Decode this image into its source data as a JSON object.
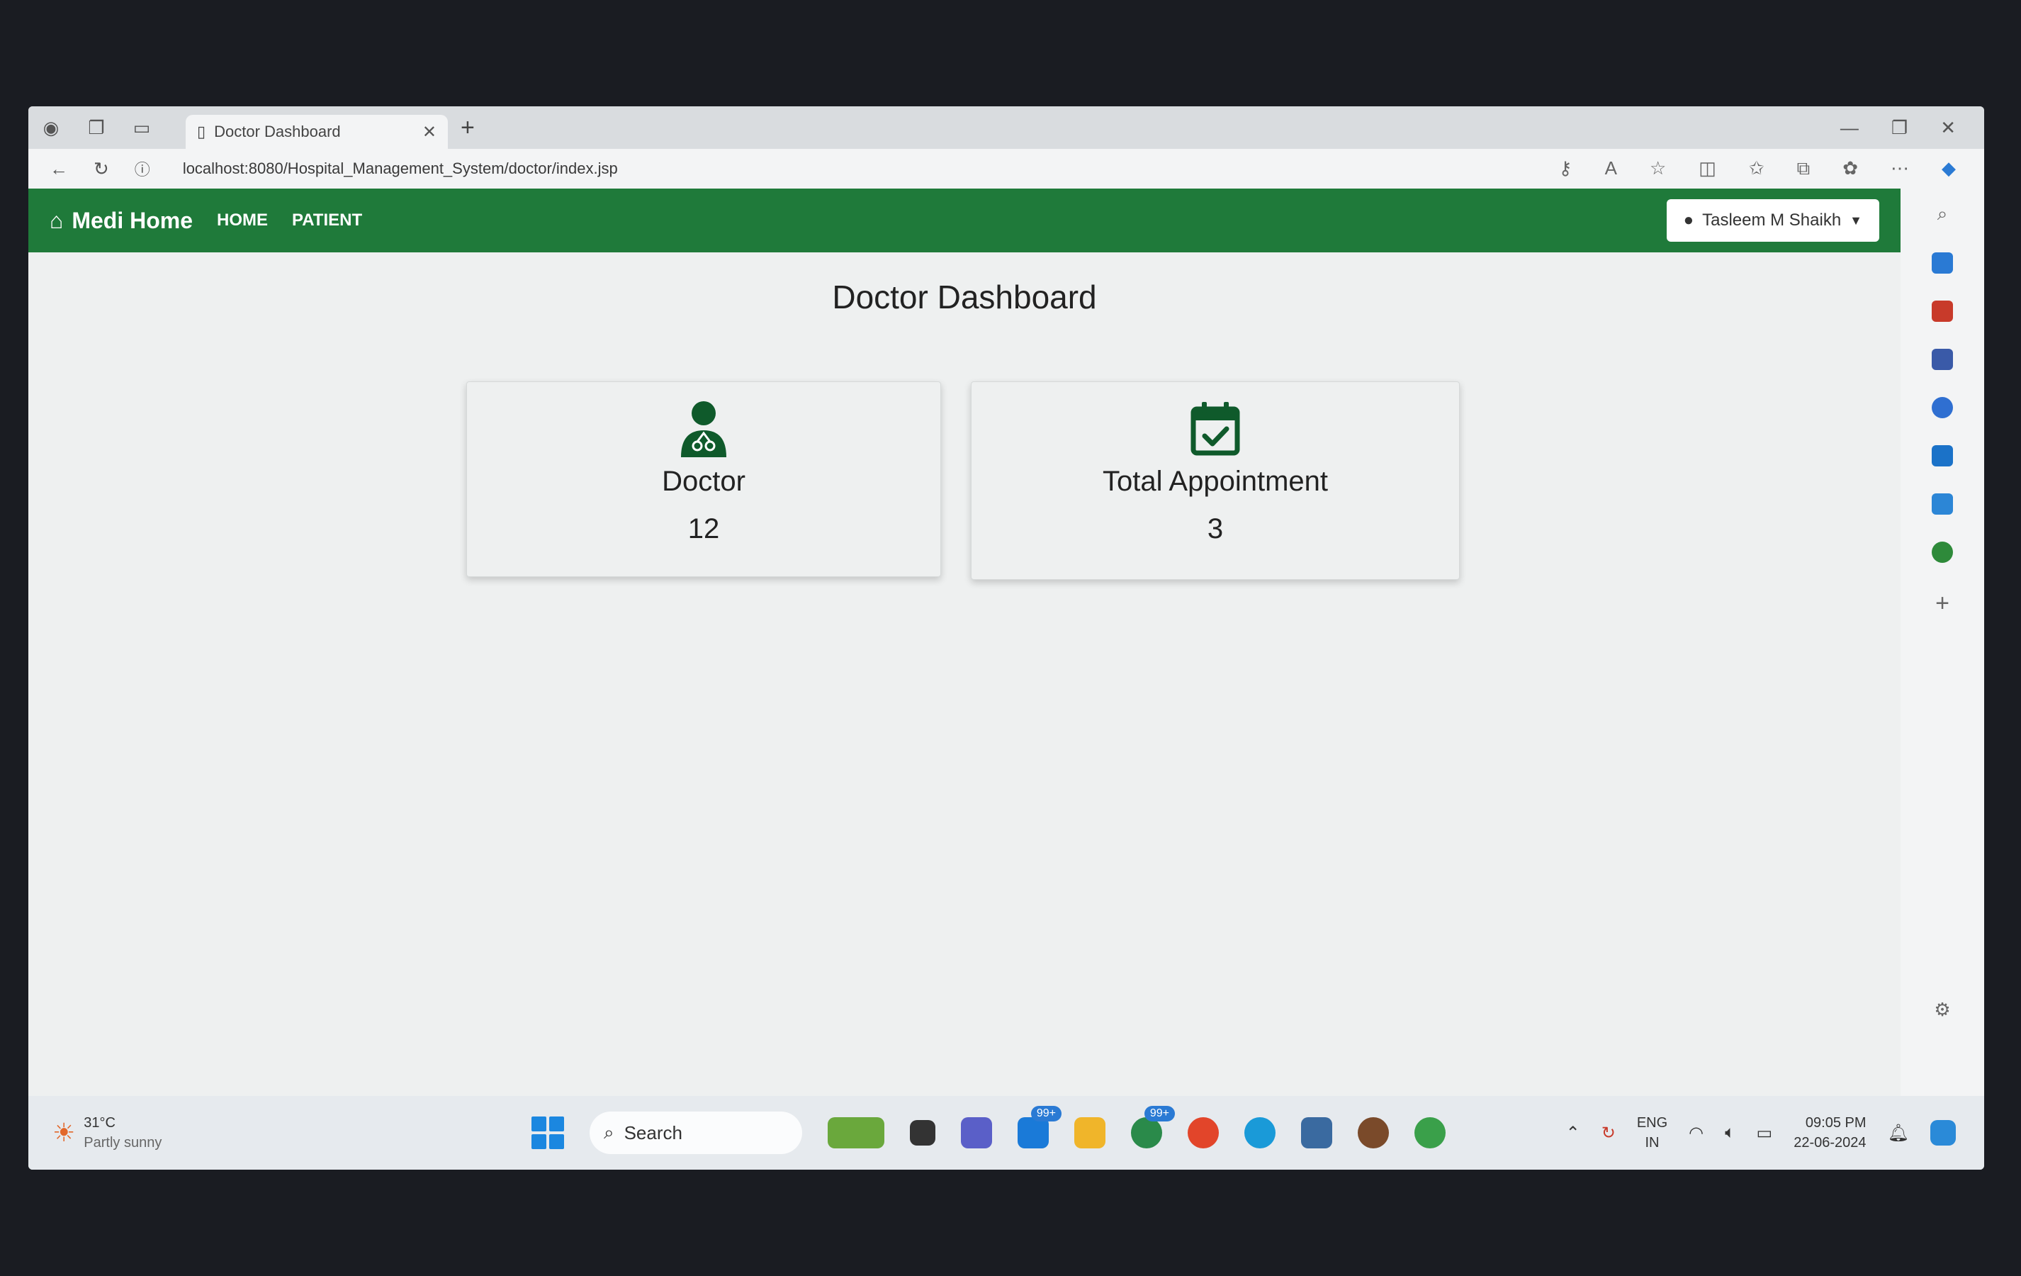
{
  "browser": {
    "tab_title": "Doctor Dashboard",
    "url": "localhost:8080/Hospital_Management_System/doctor/index.jsp"
  },
  "navbar": {
    "brand": "Medi Home",
    "links": [
      "HOME",
      "PATIENT"
    ],
    "user": "Tasleem M Shaikh"
  },
  "page": {
    "title": "Doctor Dashboard"
  },
  "cards": [
    {
      "label": "Doctor",
      "value": "12",
      "icon": "doctor-icon"
    },
    {
      "label": "Total Appointment",
      "value": "3",
      "icon": "calendar-check-icon"
    }
  ],
  "taskbar": {
    "temperature": "31°C",
    "weather": "Partly sunny",
    "search_placeholder": "Search",
    "mail_badge": "99+",
    "whatsapp_badge": "99+",
    "lang": "ENG",
    "region": "IN",
    "time": "09:05 PM",
    "date": "22-06-2024"
  },
  "colors": {
    "navbar": "#1f7a3a",
    "icon_green": "#0f5a2b"
  }
}
